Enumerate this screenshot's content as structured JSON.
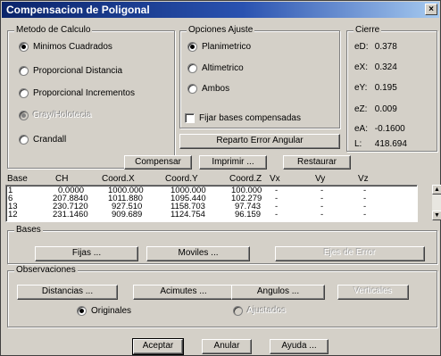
{
  "window": {
    "title": "Compensacion de Poligonal",
    "close_glyph": "×"
  },
  "metodo": {
    "legend": "Metodo de Calculo",
    "options": [
      {
        "label": "Minimos Cuadrados",
        "selected": true,
        "enabled": true
      },
      {
        "label": "Proporcional Distancia",
        "selected": false,
        "enabled": true
      },
      {
        "label": "Proporcional Incrementos",
        "selected": false,
        "enabled": true
      },
      {
        "label": "Gray/Holotecia",
        "selected": true,
        "enabled": false
      },
      {
        "label": "Crandall",
        "selected": false,
        "enabled": true
      }
    ]
  },
  "opciones": {
    "legend": "Opciones Ajuste",
    "options": [
      {
        "label": "Planimetrico",
        "selected": true
      },
      {
        "label": "Altimetrico",
        "selected": false
      },
      {
        "label": "Ambos",
        "selected": false
      }
    ],
    "fijar_label": "Fijar bases compensadas",
    "reparto_label": "Reparto Error Angular"
  },
  "cierre": {
    "legend": "Cierre",
    "rows": [
      {
        "label": "eD:",
        "value": "0.378"
      },
      {
        "label": "eX:",
        "value": "0.324"
      },
      {
        "label": "eY:",
        "value": "0.195"
      },
      {
        "label": "eZ:",
        "value": "0.009"
      },
      {
        "label": "eA:",
        "value": "-0.1600"
      },
      {
        "label": "L:",
        "value": "418.694"
      }
    ]
  },
  "actions": {
    "compensar": "Compensar",
    "imprimir": "Imprimir ...",
    "restaurar": "Restaurar"
  },
  "table": {
    "headers": [
      "Base",
      "CH",
      "Coord.X",
      "Coord.Y",
      "Coord.Z",
      "Vx",
      "Vy",
      "Vz"
    ],
    "rows": [
      [
        "1",
        "0.0000",
        "1000.000",
        "1000.000",
        "100.000",
        "-",
        "-",
        "-"
      ],
      [
        "6",
        "207.8840",
        "1011.880",
        "1095.440",
        "102.279",
        "-",
        "-",
        "-"
      ],
      [
        "13",
        "230.7120",
        "927.510",
        "1158.703",
        "97.743",
        "-",
        "-",
        "-"
      ],
      [
        "12",
        "231.1460",
        "909.689",
        "1124.754",
        "96.159",
        "-",
        "-",
        "-"
      ]
    ]
  },
  "bases": {
    "legend": "Bases",
    "fijas": "Fijas ...",
    "moviles": "Moviles ...",
    "ejes": "Ejes de Error"
  },
  "observaciones": {
    "legend": "Observaciones",
    "distancias": "Distancias ...",
    "acimutes": "Acimutes ...",
    "angulos": "Angulos ...",
    "verticales": "Verticales",
    "originales": "Originales",
    "ajustados": "Ajustados"
  },
  "footer": {
    "aceptar": "Aceptar",
    "anular": "Anular",
    "ayuda": "Ayuda ..."
  }
}
